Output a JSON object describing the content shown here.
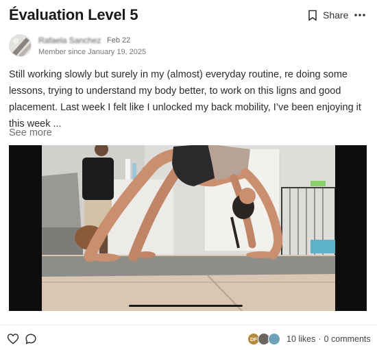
{
  "post": {
    "title": "Évaluation Level 5",
    "share_label": "Share",
    "author_name": "Rafaela Sanchez",
    "date": "Feb 22",
    "member_since": "Member since January 19, 2025",
    "body": "Still working slowly but surely in my (almost) everyday routine, re doing some lessons, trying to understand my body better, to work on this ligns and good placement. Last week I felt like I unlocked my back mobility, I’ve been enjoying it this week ...",
    "see_more": "See more"
  },
  "footer": {
    "liker_initials": "DF",
    "likes": "10 likes",
    "separator": "·",
    "comments": "0 comments"
  },
  "icons": {
    "share": "bookmark-icon",
    "more": "more-horizontal-icon",
    "like": "heart-icon",
    "comment": "comment-icon"
  },
  "colors": {
    "text": "#1a1a1a",
    "muted": "#6e6e6e",
    "video_letterbox": "#0d0d0d"
  }
}
